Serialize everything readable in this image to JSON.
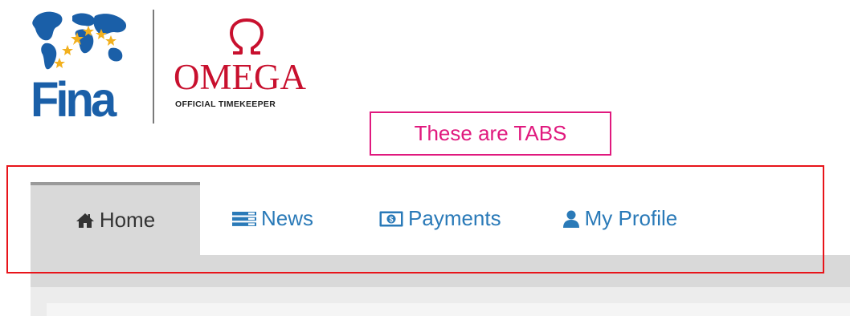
{
  "logos": {
    "fina_text": "Fina",
    "omega_text": "OMEGA",
    "omega_subtitle": "OFFICIAL TIMEKEEPER"
  },
  "annotation": {
    "label": "These are TABS",
    "color": "#e0197e",
    "highlight_color": "#e8141a"
  },
  "tabs": [
    {
      "label": "Home",
      "icon": "home-icon",
      "active": true
    },
    {
      "label": "News",
      "icon": "list-icon",
      "active": false
    },
    {
      "label": "Payments",
      "icon": "money-icon",
      "active": false
    },
    {
      "label": "My Profile",
      "icon": "user-icon",
      "active": false
    }
  ],
  "colors": {
    "tab_link": "#2a7ab8",
    "tab_active_text": "#333333",
    "tab_active_bg": "#d9d9d9",
    "fina_blue": "#1a5fa8",
    "omega_red": "#c8102e"
  }
}
